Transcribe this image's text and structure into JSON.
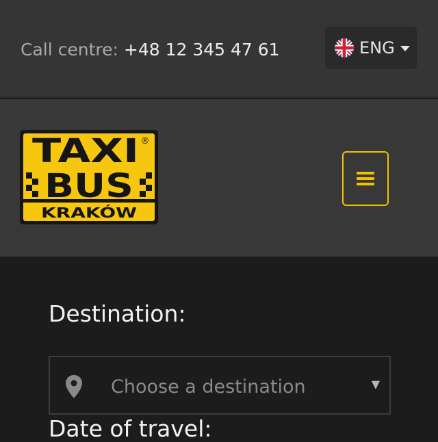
{
  "topbar": {
    "call_label": "Call centre:",
    "phone": "+48 12 345 47 61",
    "language": {
      "code": "ENG",
      "flag_icon": "uk-flag-icon",
      "caret_icon": "caret-down-icon"
    }
  },
  "header": {
    "logo": {
      "line1": "TAXI",
      "line2": "BUS",
      "line3": "KRAKÓW",
      "registered": "®"
    },
    "menu_icon": "hamburger-menu-icon"
  },
  "form": {
    "destination_label": "Destination:",
    "destination_placeholder": "Choose a destination",
    "destination_icon": "map-pin-icon",
    "select_arrow": "▼",
    "date_label": "Date of travel:"
  },
  "colors": {
    "accent": "#f2c200",
    "topbar_bg": "#353535",
    "header_bg": "#383838",
    "main_bg": "#1c1c1c"
  }
}
